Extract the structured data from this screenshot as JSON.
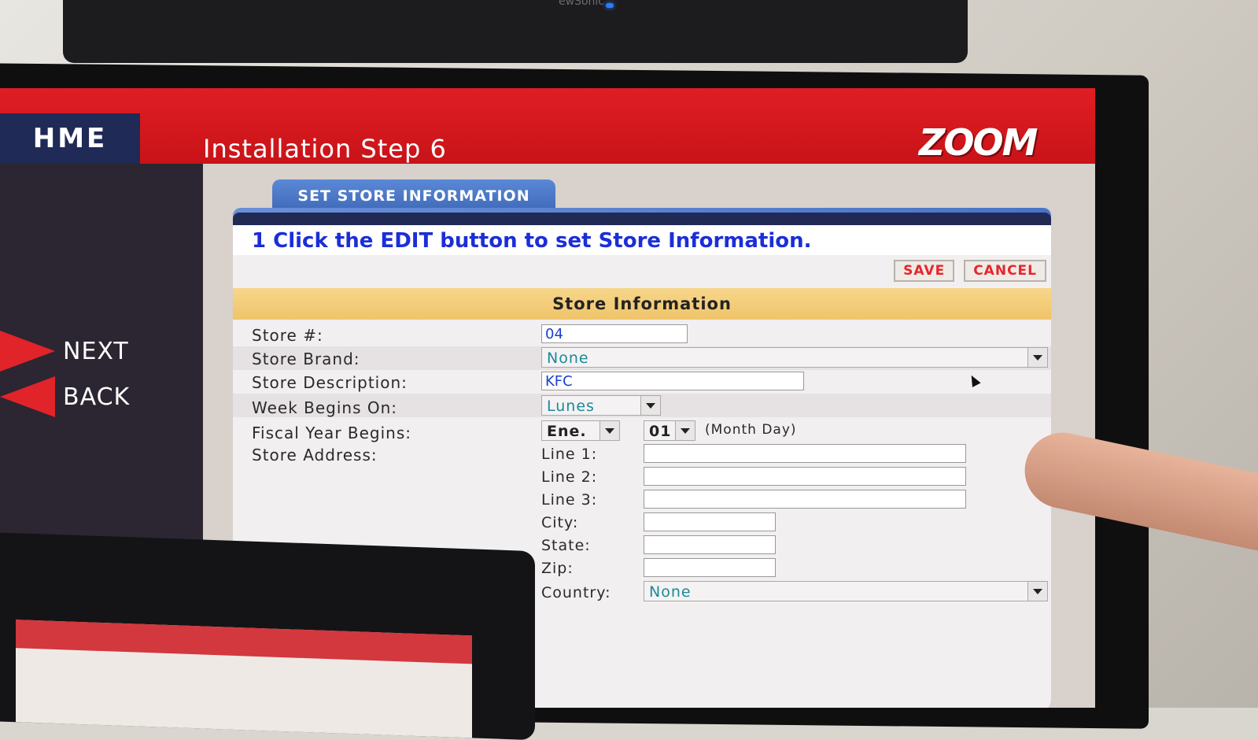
{
  "background_monitor": {
    "brand": "ewSonic"
  },
  "header": {
    "brand": "HME",
    "title": "Installation Step 6",
    "logo": "ZOOM"
  },
  "nav": {
    "next": "NEXT",
    "back": "BACK"
  },
  "tab": "SET STORE INFORMATION",
  "instruction": "1 Click the EDIT button to set Store Information.",
  "actions": {
    "save": "SAVE",
    "cancel": "CANCEL"
  },
  "section_title": "Store Information",
  "fields": {
    "store_number": {
      "label": "Store #:",
      "value": "04"
    },
    "store_brand": {
      "label": "Store Brand:",
      "value": "None"
    },
    "store_description": {
      "label": "Store Description:",
      "value": "KFC"
    },
    "week_begins": {
      "label": "Week Begins On:",
      "value": "Lunes"
    },
    "fiscal_year": {
      "label": "Fiscal Year Begins:",
      "month": "Ene.",
      "day": "01",
      "hint": "(Month Day)"
    },
    "address": {
      "label": "Store Address:",
      "line1": "Line 1:",
      "line2": "Line 2:",
      "line3": "Line 3:",
      "city": "City:",
      "state": "State:",
      "zip": "Zip:",
      "country": {
        "label": "Country:",
        "value": "None"
      }
    }
  },
  "icons": {
    "next": "arrow-right-icon",
    "back": "arrow-left-icon",
    "dropdown": "chevron-down-icon",
    "cursor": "mouse-cursor-icon"
  },
  "colors": {
    "header_red": "#e01e24",
    "brand_navy": "#1f2a57",
    "instruction_blue": "#1b2ed8",
    "section_gold": "#f7d68a",
    "value_teal": "#1a8a9a"
  }
}
